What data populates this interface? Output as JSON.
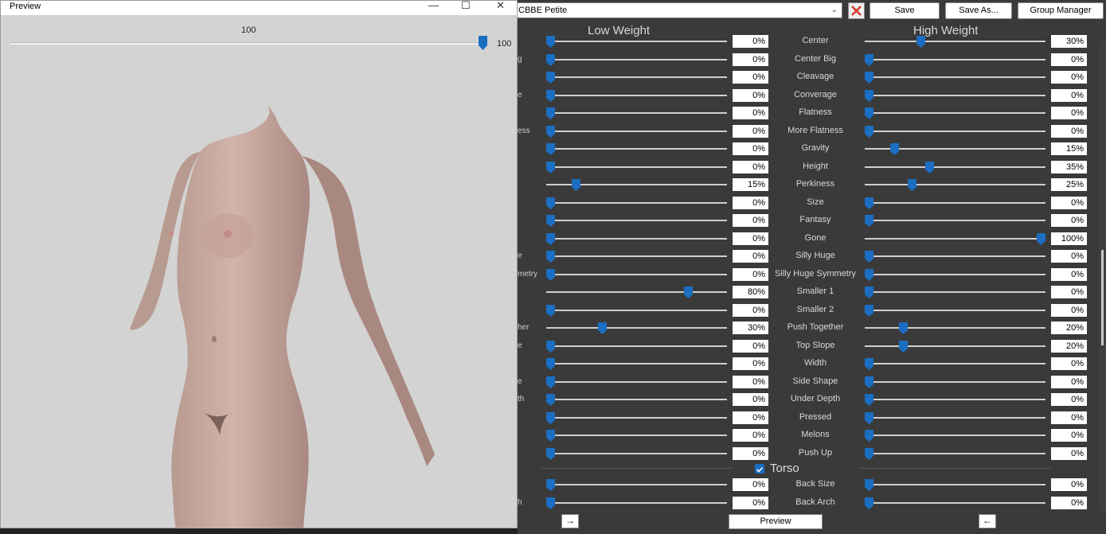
{
  "toolbar": {
    "preset_name": "CBBE Petite",
    "save_label": "Save",
    "save_as_label": "Save As...",
    "group_manager_label": "Group Manager"
  },
  "headers": {
    "low": "Low Weight",
    "high": "High Weight"
  },
  "rows": [
    {
      "name": "Center",
      "left_label": "",
      "low": 0,
      "high": 30
    },
    {
      "name": "Center Big",
      "left_label": "g",
      "low": 0,
      "high": 0
    },
    {
      "name": "Cleavage",
      "left_label": "",
      "low": 0,
      "high": 0
    },
    {
      "name": "Converage",
      "left_label": "e",
      "low": 0,
      "high": 0
    },
    {
      "name": "Flatness",
      "left_label": "",
      "low": 0,
      "high": 0
    },
    {
      "name": "More Flatness",
      "left_label": "ess",
      "low": 0,
      "high": 0
    },
    {
      "name": "Gravity",
      "left_label": "",
      "low": 0,
      "high": 15
    },
    {
      "name": "Height",
      "left_label": "",
      "low": 0,
      "high": 35
    },
    {
      "name": "Perkiness",
      "left_label": "",
      "low": 15,
      "high": 25
    },
    {
      "name": "Size",
      "left_label": "",
      "low": 0,
      "high": 0
    },
    {
      "name": "Fantasy",
      "left_label": "",
      "low": 0,
      "high": 0
    },
    {
      "name": "Gone",
      "left_label": "",
      "low": 0,
      "high": 100
    },
    {
      "name": "Silly Huge",
      "left_label": "e",
      "low": 0,
      "high": 0
    },
    {
      "name": "Silly Huge Symmetry",
      "left_label": "metry",
      "low": 0,
      "high": 0
    },
    {
      "name": "Smaller 1",
      "left_label": "",
      "low": 80,
      "high": 0
    },
    {
      "name": "Smaller 2",
      "left_label": "",
      "low": 0,
      "high": 0
    },
    {
      "name": "Push Together",
      "left_label": "her",
      "low": 30,
      "high": 20
    },
    {
      "name": "Top Slope",
      "left_label": "e",
      "low": 0,
      "high": 20
    },
    {
      "name": "Width",
      "left_label": "",
      "low": 0,
      "high": 0
    },
    {
      "name": "Side Shape",
      "left_label": "e",
      "low": 0,
      "high": 0
    },
    {
      "name": "Under Depth",
      "left_label": "th",
      "low": 0,
      "high": 0
    },
    {
      "name": "Pressed",
      "left_label": "",
      "low": 0,
      "high": 0
    },
    {
      "name": "Melons",
      "left_label": "",
      "low": 0,
      "high": 0
    },
    {
      "name": "Push Up",
      "left_label": "",
      "low": 0,
      "high": 0
    }
  ],
  "section": {
    "label": "Torso",
    "checked": true
  },
  "torso_rows": [
    {
      "name": "Back Size",
      "left_label": "",
      "low": 0,
      "high": 0
    },
    {
      "name": "Back Arch",
      "left_label": "h",
      "low": 0,
      "high": 0
    }
  ],
  "bottom": {
    "preview_label": "Preview",
    "left_arrow": "→",
    "right_arrow": "←"
  },
  "preview_window": {
    "title": "Preview",
    "slider_label": "100",
    "slider_value": "100",
    "slider_level": 100,
    "minimize": "—",
    "maximize": "☐",
    "close": "✕"
  },
  "colors": {
    "accent": "#1b6ec2",
    "panel_bg": "#3a3a3a",
    "preview_bg": "#d3d3d3",
    "close_x": "#d23a2a"
  },
  "icons": {
    "clear_preset": "close-x-icon",
    "slider_thumb": "slider-thumb-icon"
  }
}
